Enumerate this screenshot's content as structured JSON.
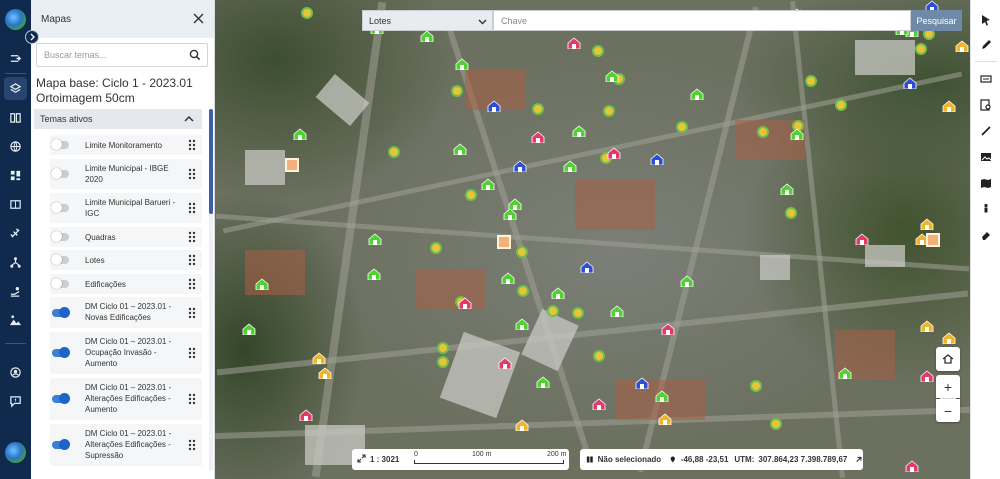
{
  "sidebar": {
    "title": "Mapas",
    "search_placeholder": "Buscar temas...",
    "map_base_line1": "Mapa base: Ciclo 1 - 2023.01",
    "map_base_line2": "Ortoimagem 50cm",
    "section_title": "Temas ativos",
    "layers": [
      {
        "label": "Limite Monitoramento",
        "on": false
      },
      {
        "label": "Limite Municipal - IBGE 2020",
        "on": false
      },
      {
        "label": "Limite Municipal Barueri - IGC",
        "on": false
      },
      {
        "label": "Quadras",
        "on": false
      },
      {
        "label": "Lotes",
        "on": false
      },
      {
        "label": "Edificações",
        "on": false
      },
      {
        "label": "DM Ciclo 01 – 2023.01 - Novas Edificações",
        "on": true
      },
      {
        "label": "DM Ciclo 01 – 2023.01 - Ocupação Invasão - Aumento",
        "on": true
      },
      {
        "label": "DM Ciclo 01 – 2023.01 - Alterações Edificações - Aumento",
        "on": true
      },
      {
        "label": "DM Ciclo 01 – 2023.01 - Alterações Edificações - Supressão",
        "on": true
      }
    ]
  },
  "search": {
    "type_selected": "Lotes",
    "placeholder": "Chave",
    "button": "Pesquisar"
  },
  "scale": {
    "ratio": "1 : 3021",
    "tick0": "0",
    "tick1": "100 m",
    "tick2": "200 m"
  },
  "status": {
    "selection": "Não selecionado",
    "latlon": "-46,88 -23,51",
    "utm_label": "UTM:",
    "utm": "307.864,23 7.398.789,67"
  },
  "colors": {
    "rail": "#0f2a4d",
    "accent": "#1e64c8",
    "new_building": "#4fd12f",
    "invasion": "#e23b6b",
    "alteration_increase": "#f0b429",
    "blue_marker": "#2d4fd6"
  }
}
